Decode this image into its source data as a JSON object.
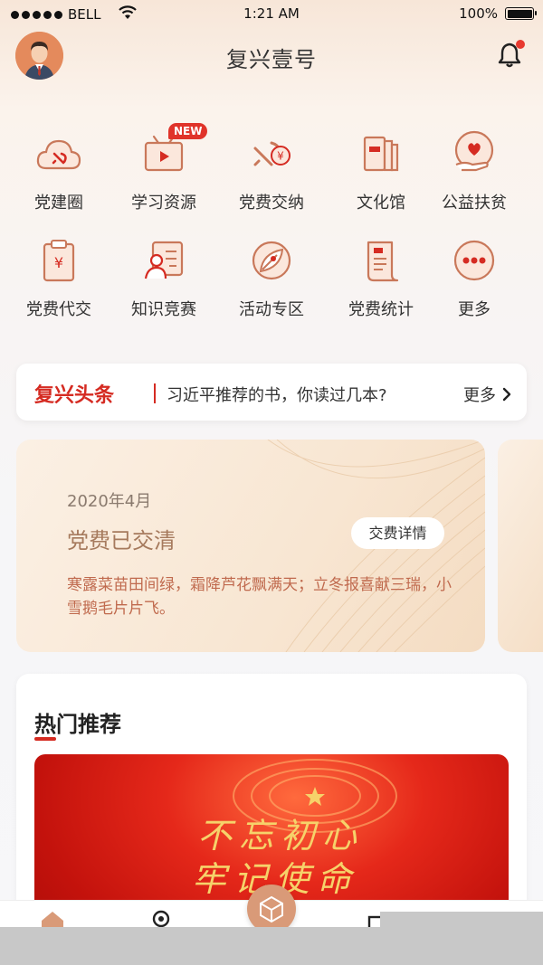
{
  "status_bar": {
    "carrier": "BELL",
    "time": "1:21 AM",
    "battery": "100%"
  },
  "header": {
    "title": "复兴壹号"
  },
  "grid": {
    "new_badge": "NEW",
    "items": [
      {
        "label": "党建圈",
        "icon": "party-cloud-icon"
      },
      {
        "label": "学习资源",
        "icon": "video-tv-icon"
      },
      {
        "label": "党费交纳",
        "icon": "party-yuan-icon"
      },
      {
        "label": "文化馆",
        "icon": "books-icon"
      },
      {
        "label": "公益扶贫",
        "icon": "heart-hand-icon"
      },
      {
        "label": "党费代交",
        "icon": "clipboard-yuan-icon"
      },
      {
        "label": "知识竞赛",
        "icon": "person-board-icon"
      },
      {
        "label": "活动专区",
        "icon": "leaf-circle-icon"
      },
      {
        "label": "党费统计",
        "icon": "receipt-icon"
      },
      {
        "label": "更多",
        "icon": "more-dots-icon"
      }
    ]
  },
  "headline": {
    "brand": "复兴头条",
    "text": "习近平推荐的书，你读过几本?",
    "more": "更多"
  },
  "fee_card": {
    "date": "2020年4月",
    "status": "党费已交清",
    "button": "交费详情",
    "poem": "寒露菜苗田间绿，霜降芦花飘满天；立冬报喜献三瑞，小雪鹅毛片片飞。"
  },
  "hot": {
    "title": "热门推荐",
    "banner_slogan_line1": "不忘初心",
    "banner_slogan_line2": "牢记使命"
  },
  "colors": {
    "brand_red": "#d52b22",
    "accent_copper": "#c9785a"
  }
}
